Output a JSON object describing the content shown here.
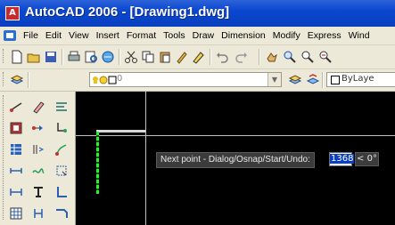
{
  "window": {
    "title": "AutoCAD 2006 - [Drawing1.dwg]"
  },
  "menu": {
    "items": [
      "File",
      "Edit",
      "View",
      "Insert",
      "Format",
      "Tools",
      "Draw",
      "Dimension",
      "Modify",
      "Express",
      "Wind"
    ]
  },
  "layers_toolbar": {
    "layer_value": "0",
    "bylayer_value": "ByLaye"
  },
  "dynamic_input": {
    "prompt": "Next point - Dialog/Osnap/Start/Undo:",
    "value": "1368",
    "angle": "< 0°"
  },
  "colors": {
    "titlebar": "#0a3fbf",
    "canvas": "#000000",
    "line": "#2cf02c",
    "chrome": "#ece9d8"
  }
}
